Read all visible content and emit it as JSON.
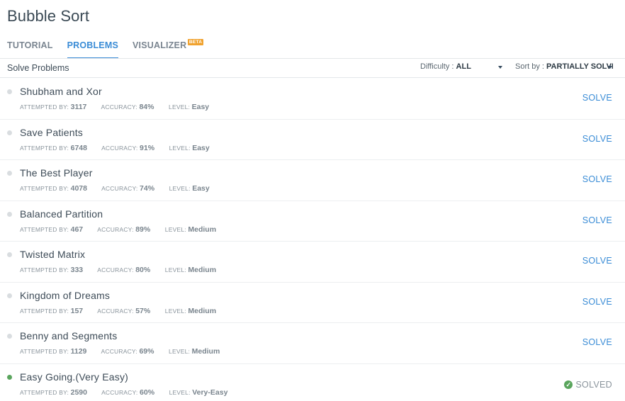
{
  "page": {
    "title": "Bubble Sort"
  },
  "tabs": [
    {
      "label": "TUTORIAL",
      "active": false
    },
    {
      "label": "PROBLEMS",
      "active": true
    },
    {
      "label": "VISUALIZER",
      "active": false,
      "badge": "BETA"
    }
  ],
  "toolbar": {
    "label": "Solve Problems",
    "difficulty_label": "Difficulty : ",
    "difficulty_value": "ALL",
    "sort_label": "Sort by : ",
    "sort_value": "PARTIALLY SOLVED"
  },
  "meta_labels": {
    "attempted": "ATTEMPTED BY: ",
    "accuracy": "ACCURACY: ",
    "level": "LEVEL: "
  },
  "actions": {
    "solve": "SOLVE",
    "solved": "SOLVED"
  },
  "problems": [
    {
      "name": "Shubham and Xor",
      "attempted": "3117",
      "accuracy": "84%",
      "level": "Easy",
      "status": "SOLVE"
    },
    {
      "name": "Save Patients",
      "attempted": "6748",
      "accuracy": "91%",
      "level": "Easy",
      "status": "SOLVE"
    },
    {
      "name": "The Best Player",
      "attempted": "4078",
      "accuracy": "74%",
      "level": "Easy",
      "status": "SOLVE"
    },
    {
      "name": "Balanced Partition",
      "attempted": "467",
      "accuracy": "89%",
      "level": "Medium",
      "status": "SOLVE"
    },
    {
      "name": "Twisted Matrix",
      "attempted": "333",
      "accuracy": "80%",
      "level": "Medium",
      "status": "SOLVE"
    },
    {
      "name": "Kingdom of Dreams",
      "attempted": "157",
      "accuracy": "57%",
      "level": "Medium",
      "status": "SOLVE"
    },
    {
      "name": "Benny and Segments",
      "attempted": "1129",
      "accuracy": "69%",
      "level": "Medium",
      "status": "SOLVE"
    },
    {
      "name": "Easy Going.(Very Easy)",
      "attempted": "2590",
      "accuracy": "60%",
      "level": "Very-Easy",
      "status": "SOLVED"
    }
  ],
  "colors": {
    "accent": "#3a8cd6",
    "solved": "#5aa55d",
    "beta_badge": "#f0a22e"
  },
  "icons": {
    "solved": "check-circle-icon",
    "dropdown": "caret-down-icon"
  }
}
